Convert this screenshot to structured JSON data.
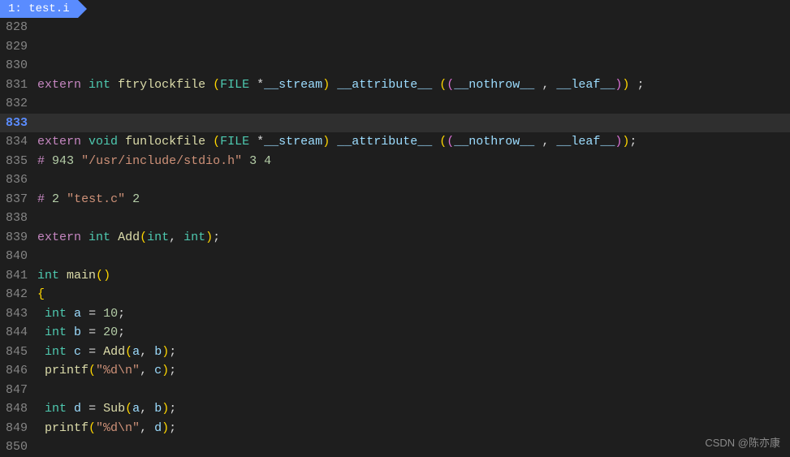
{
  "tab": {
    "label": "1: test.i"
  },
  "lines": {
    "l828": "828",
    "l829": "829",
    "l830": "830",
    "l831": "831",
    "l832": "832",
    "l833": "833",
    "l834": "834",
    "l835": "835",
    "l836": "836",
    "l837": "837",
    "l838": "838",
    "l839": "839",
    "l840": "840",
    "l841": "841",
    "l842": "842",
    "l843": "843",
    "l844": "844",
    "l845": "845",
    "l846": "846",
    "l847": "847",
    "l848": "848",
    "l849": "849",
    "l850": "850"
  },
  "tok": {
    "extern": "extern",
    "int": "int",
    "void": "void",
    "ftrylockfile": "ftrylockfile",
    "funlockfile": "funlockfile",
    "FILE": "FILE",
    "stream": "__stream",
    "attribute": "__attribute__",
    "nothrow": "__nothrow__",
    "leaf": "__leaf__",
    "star": "*",
    "hash": "#",
    "n943": "943",
    "stdio": "\"/usr/include/stdio.h\"",
    "n3": "3",
    "n4": "4",
    "n2a": "2",
    "testc": "\"test.c\"",
    "n2b": "2",
    "Add": "Add",
    "Sub": "Sub",
    "main": "main",
    "a": "a",
    "b": "b",
    "c": "c",
    "d": "d",
    "n10": "10",
    "n20": "20",
    "printf": "printf",
    "fmt": "\"%d\\n\"",
    "eq": "=",
    "sc": ";",
    "cm": ",",
    "lp": "(",
    "rp": ")",
    "lp2": "(",
    "rp2": ")",
    "lb": "{",
    "rb": "}",
    "sp": " "
  },
  "watermark": "CSDN @陈亦康"
}
